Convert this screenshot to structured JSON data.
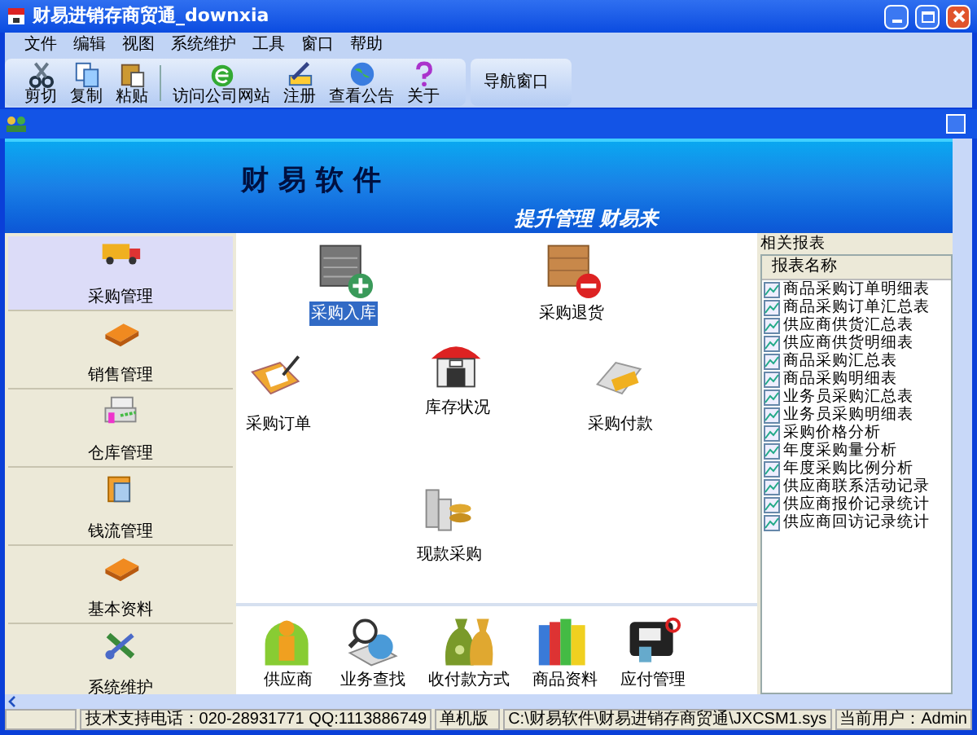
{
  "window": {
    "title": "财易进销存商贸通_downxia"
  },
  "menu": [
    "文件",
    "编辑",
    "视图",
    "系统维护",
    "工具",
    "窗口",
    "帮助"
  ],
  "toolbar": [
    "剪切",
    "复制",
    "粘贴",
    "访问公司网站",
    "注册",
    "查看公告",
    "关于"
  ],
  "nav_toolbar": {
    "label": "导航窗口"
  },
  "banner": {
    "title": "财 易 软 件",
    "slogan": "提升管理 财易来"
  },
  "sidebar": {
    "items": [
      {
        "label": "采购管理",
        "selected": true
      },
      {
        "label": "销售管理",
        "selected": false
      },
      {
        "label": "仓库管理",
        "selected": false
      },
      {
        "label": "钱流管理",
        "selected": false
      },
      {
        "label": "基本资料",
        "selected": false
      },
      {
        "label": "系统维护",
        "selected": false
      }
    ]
  },
  "workspace": {
    "items": [
      {
        "label": "采购入库",
        "selected": true
      },
      {
        "label": "采购退货",
        "selected": false
      },
      {
        "label": "采购订单",
        "selected": false
      },
      {
        "label": "库存状况",
        "selected": false
      },
      {
        "label": "采购付款",
        "selected": false
      },
      {
        "label": "现款采购",
        "selected": false
      }
    ]
  },
  "shortcuts": [
    "供应商",
    "业务查找",
    "收付款方式",
    "商品资料",
    "应付管理"
  ],
  "reports": {
    "title": "相关报表",
    "column": "报表名称",
    "items": [
      "商品采购订单明细表",
      "商品采购订单汇总表",
      "供应商供货汇总表",
      "供应商供货明细表",
      "商品采购汇总表",
      "商品采购明细表",
      "业务员采购汇总表",
      "业务员采购明细表",
      "采购价格分析",
      "年度采购量分析",
      "年度采购比例分析",
      "供应商联系活动记录",
      "供应商报价记录统计",
      "供应商回访记录统计"
    ]
  },
  "status_bar": [
    "技术支持电话：020-28931771 QQ:1113886749",
    "单机版",
    "C:\\财易软件\\财易进销存商贸通\\JXCSM1.sys",
    "当前用户：Admin"
  ]
}
